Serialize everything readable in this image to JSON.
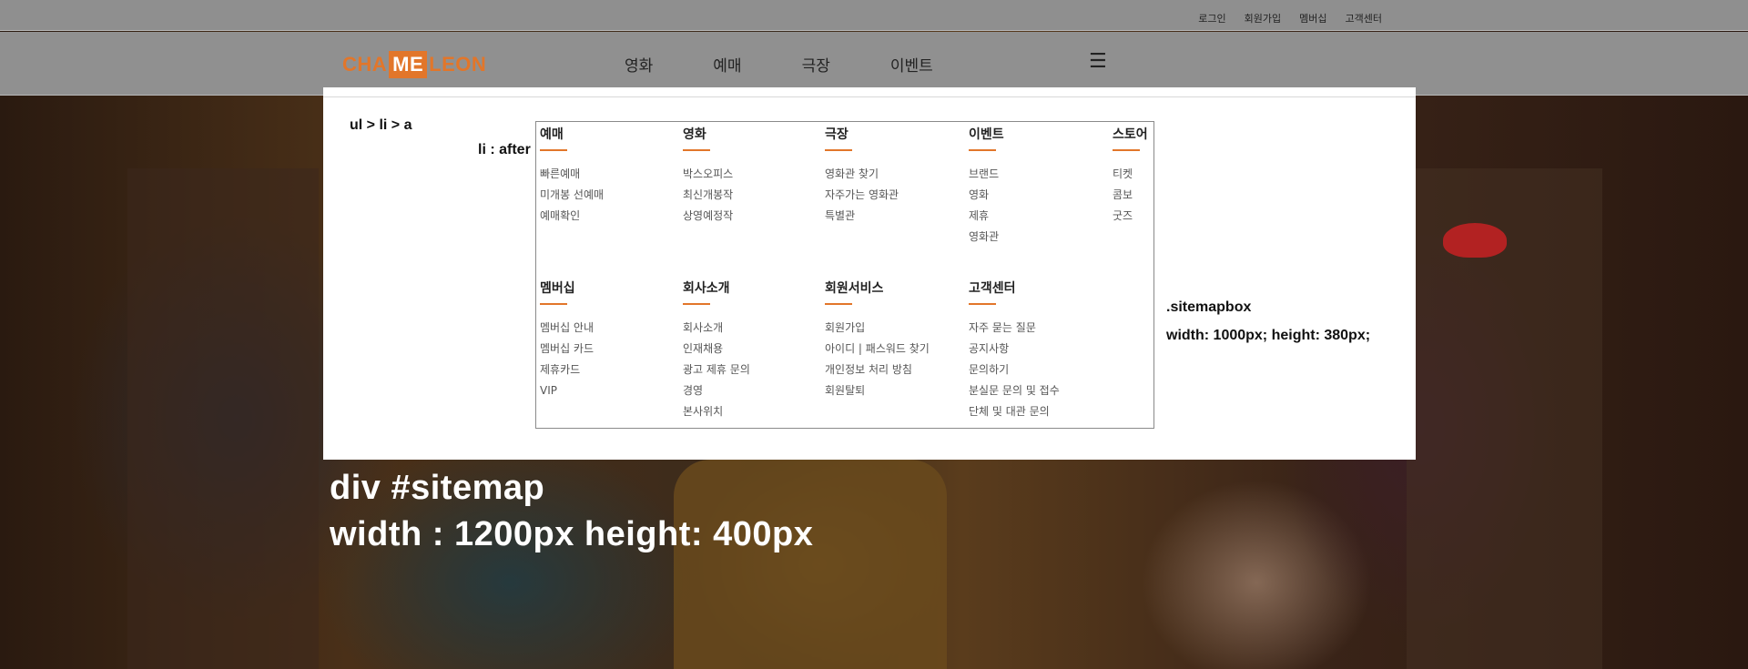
{
  "utility_nav": [
    "로그인",
    "회원가입",
    "멤버십",
    "고객센터"
  ],
  "logo": {
    "part1": "CHA",
    "part2": "ME",
    "part3": "LEON"
  },
  "gnb": [
    "영화",
    "예매",
    "극장",
    "이벤트"
  ],
  "menu_icon": "☰",
  "annotations": {
    "ul_li_a": "ul > li > a",
    "li_after": "li : after",
    "sitemapbox_class": ".sitemapbox",
    "sitemapbox_size": "width: 1000px; height: 380px;",
    "sitemap_id": "div #sitemap",
    "sitemap_size": "width : 1200px height: 400px"
  },
  "sitemap": {
    "row1": [
      {
        "title": "예매",
        "items": [
          "빠른예매",
          "미개봉 선예매",
          "예매확인"
        ]
      },
      {
        "title": "영화",
        "items": [
          "박스오피스",
          "최신개봉작",
          "상영예정작"
        ]
      },
      {
        "title": "극장",
        "items": [
          "영화관 찾기",
          "자주가는 영화관",
          "특별관"
        ]
      },
      {
        "title": "이벤트",
        "items": [
          "브랜드",
          "영화",
          "제휴",
          "영화관"
        ]
      },
      {
        "title": "스토어",
        "items": [
          "티켓",
          "콤보",
          "굿즈"
        ]
      }
    ],
    "row2": [
      {
        "title": "멤버십",
        "items": [
          "멤버십 안내",
          "멤버십 카드",
          "제휴카드",
          "VIP"
        ]
      },
      {
        "title": "회사소개",
        "items": [
          "회사소개",
          "인재채용",
          "광고 제휴 문의",
          "경영",
          "본사위치"
        ]
      },
      {
        "title": "회원서비스",
        "items": [
          "회원가입",
          "아이디 | 패스워드 찾기",
          "개인정보 처리 방침",
          "회원탈퇴"
        ]
      },
      {
        "title": "고객센터",
        "items": [
          "자주 묻는 질문",
          "공지사항",
          "문의하기",
          "분실문 문의 및 접수",
          "단체 및 대관 문의"
        ]
      }
    ]
  },
  "colors": {
    "accent": "#e2762a",
    "header_bg": "#909090",
    "sitemap_bg": "#ffffff"
  }
}
